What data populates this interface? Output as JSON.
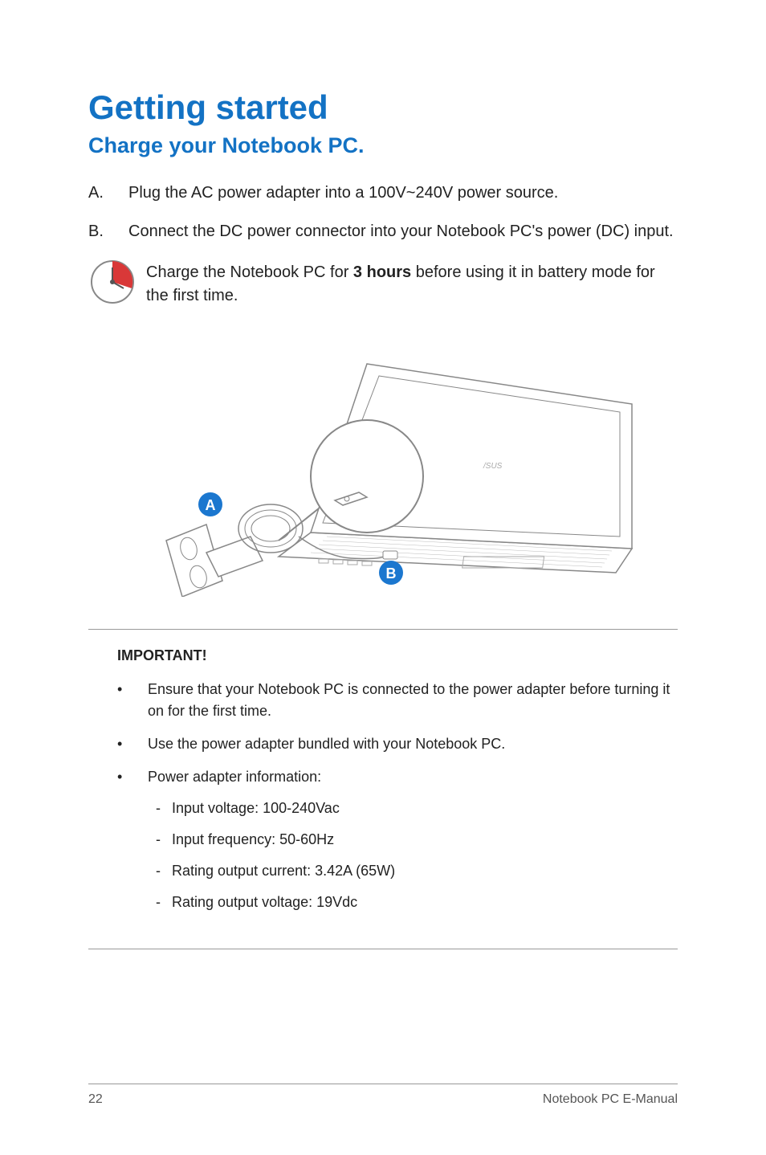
{
  "heading": {
    "title": "Getting started",
    "subtitle": "Charge your Notebook PC."
  },
  "steps": [
    {
      "letter": "A.",
      "text": "Plug the AC power adapter into a 100V~240V power source."
    },
    {
      "letter": "B.",
      "text": "Connect the DC power connector into your Notebook PC's power (DC) input."
    }
  ],
  "clock_note": {
    "pre": "Charge the Notebook PC for ",
    "bold": "3 hours",
    "post": " before using it in battery mode for the first time."
  },
  "diagram": {
    "callout_a": "A",
    "callout_b": "B"
  },
  "important": {
    "heading": "IMPORTANT!",
    "bullets": [
      {
        "text": "Ensure that your Notebook PC is connected to the power adapter before turning it on for the first time."
      },
      {
        "text": "Use the power adapter bundled with your Notebook PC."
      },
      {
        "text": "Power adapter information:",
        "sub": [
          "Input voltage: 100-240Vac",
          "Input frequency: 50-60Hz",
          "Rating output current: 3.42A (65W)",
          "Rating output voltage: 19Vdc"
        ]
      }
    ]
  },
  "footer": {
    "page": "22",
    "doc": "Notebook PC E-Manual"
  }
}
